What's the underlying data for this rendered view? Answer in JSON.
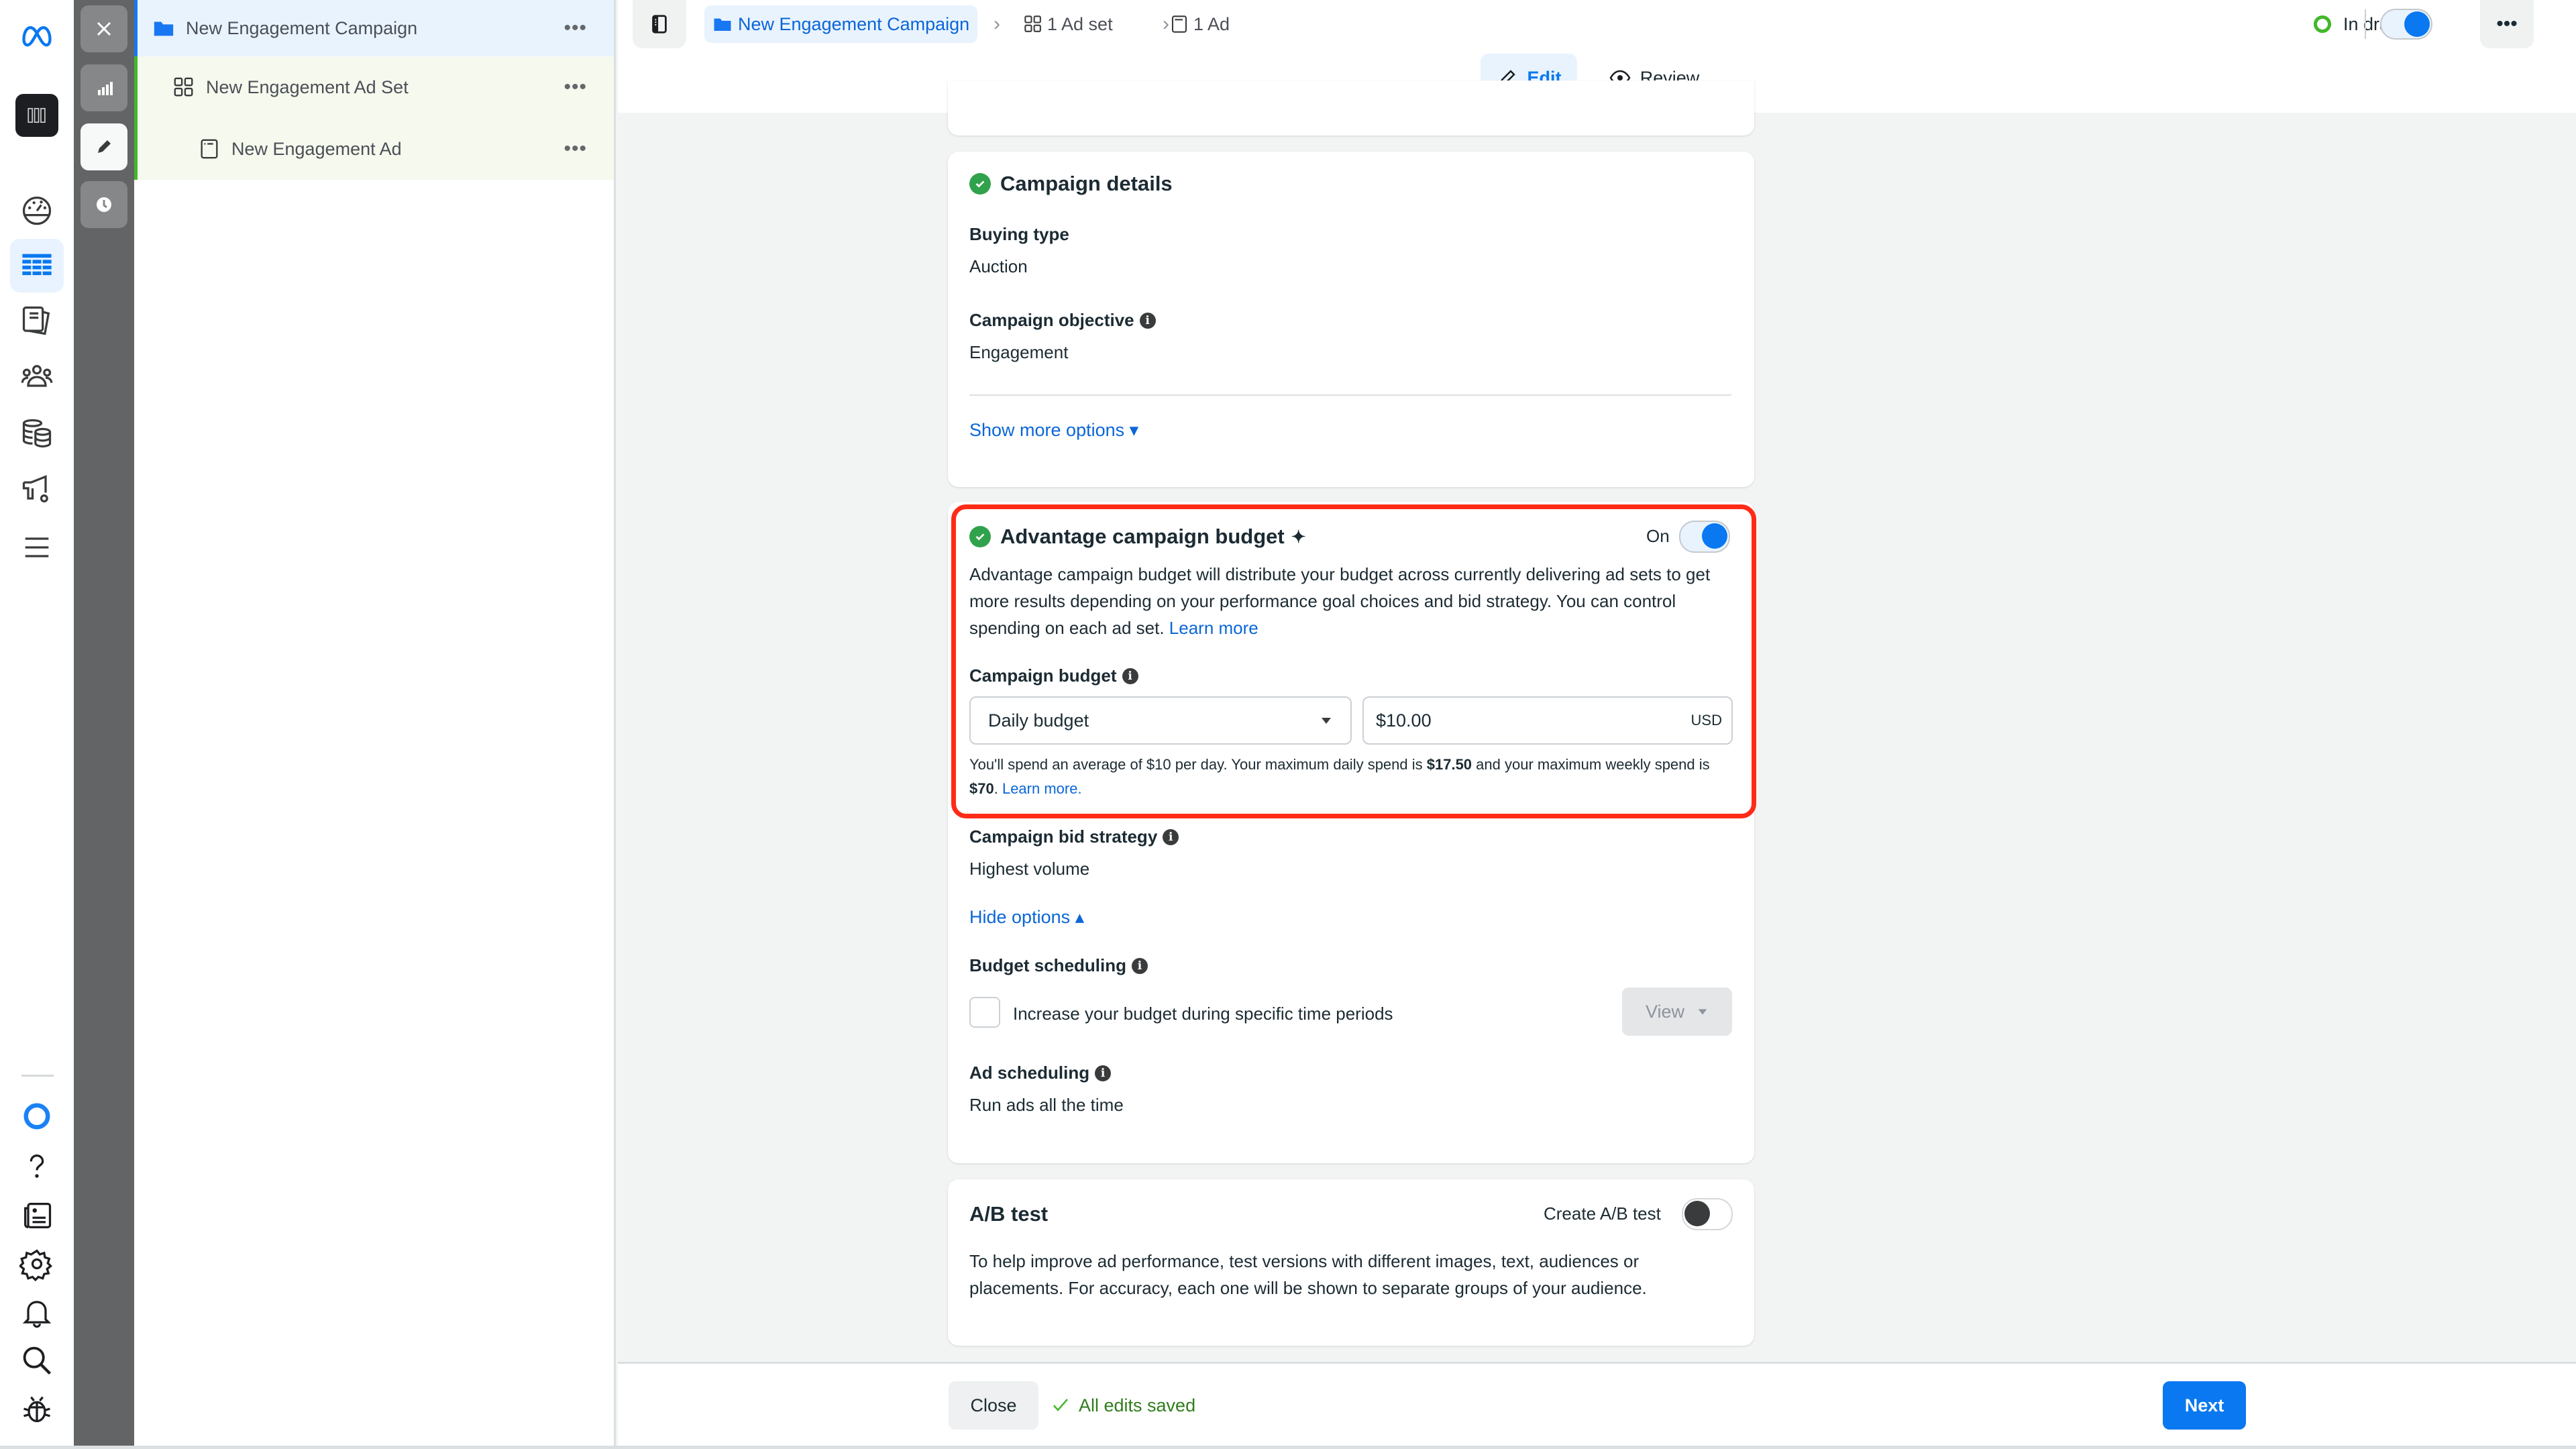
{
  "tree": {
    "campaign": "New Engagement Campaign",
    "ad_set": "New Engagement Ad Set",
    "ad": "New Engagement Ad",
    "more_label": "•••"
  },
  "topbar": {
    "breadcrumb_campaign": "New Engagement Campaign",
    "breadcrumb_adset": "1 Ad set",
    "breadcrumb_ad": "1 Ad",
    "separator": "›",
    "status": "In draft",
    "more_label": "•••",
    "tabs": {
      "edit": "Edit",
      "review": "Review"
    }
  },
  "campaign_details": {
    "title": "Campaign details",
    "buying_type_label": "Buying type",
    "buying_type_value": "Auction",
    "objective_label": "Campaign objective",
    "objective_value": "Engagement",
    "show_more": "Show more options ▾"
  },
  "advantage_budget": {
    "title": "Advantage campaign budget",
    "sparkle": "✦",
    "toggle_label": "On",
    "toggle_on": true,
    "description": "Advantage campaign budget will distribute your budget across currently delivering ad sets to get more results depending on your performance goal choices and bid strategy. You can control spending on each ad set.",
    "learn_more": "Learn more",
    "budget_label": "Campaign budget",
    "budget_type": "Daily budget",
    "budget_amount": "$10.00",
    "currency": "USD",
    "spend_note_1": "You'll spend an average of $10 per day. Your maximum daily spend is ",
    "spend_max_daily": "$17.50",
    "spend_note_2": " and your maximum weekly spend is ",
    "spend_max_weekly": "$70",
    "spend_note_3": ". ",
    "spend_learn_more": "Learn more."
  },
  "bid": {
    "label": "Campaign bid strategy",
    "value": "Highest volume",
    "hide_options": "Hide options ▴",
    "budget_scheduling_label": "Budget scheduling",
    "budget_scheduling_checkbox": "Increase your budget during specific time periods",
    "view_button": "View",
    "ad_scheduling_label": "Ad scheduling",
    "ad_scheduling_value": "Run ads all the time"
  },
  "ab_test": {
    "title": "A/B test",
    "toggle_label": "Create A/B test",
    "toggle_on": false,
    "description": "To help improve ad performance, test versions with different images, text, audiences or placements. For accuracy, each one will be shown to separate groups of your audience."
  },
  "footer": {
    "close": "Close",
    "saved": "All edits saved",
    "next": "Next"
  },
  "colors": {
    "accent": "#0a78f0",
    "success": "#31a24c",
    "highlight": "#ff2b17"
  }
}
